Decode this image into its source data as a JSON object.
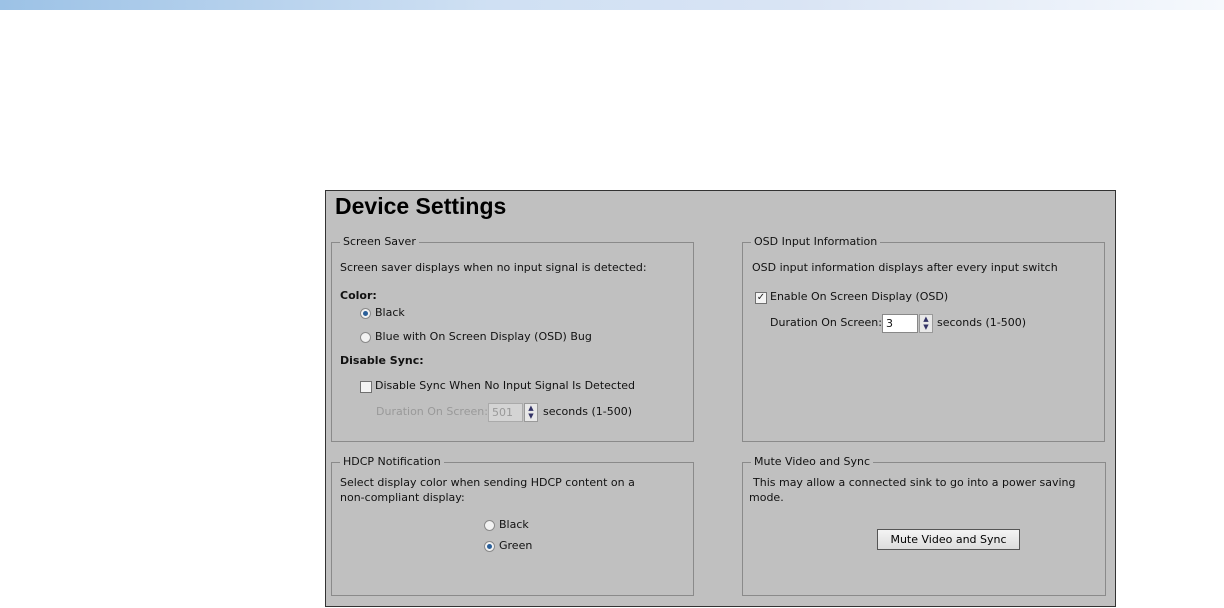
{
  "page": {
    "title": "Device Settings"
  },
  "screen_saver": {
    "legend": "Screen Saver",
    "description": "Screen saver displays when no input signal is detected:",
    "color_label": "Color:",
    "options": [
      {
        "label": "Black",
        "selected": true
      },
      {
        "label": "Blue with On Screen Display (OSD) Bug",
        "selected": false
      }
    ],
    "disable_sync_label": "Disable Sync:",
    "disable_sync_checkbox": "Disable Sync When No Input Signal Is Detected",
    "disable_sync_checked": false,
    "duration_label": "Duration On Screen:",
    "duration_value": "501",
    "duration_units": "seconds (1-500)"
  },
  "osd": {
    "legend": "OSD Input Information",
    "description": "OSD input information displays after every input switch",
    "enable_label": "Enable On Screen Display (OSD)",
    "enable_checked": true,
    "duration_label": "Duration On Screen:",
    "duration_value": "3",
    "duration_units": "seconds (1-500)"
  },
  "hdcp": {
    "legend": "HDCP Notification",
    "description_line1": "Select display color when sending HDCP content on a",
    "description_line2": "non-compliant display:",
    "options": [
      {
        "label": "Black",
        "selected": false
      },
      {
        "label": "Green",
        "selected": true
      }
    ]
  },
  "mute": {
    "legend": "Mute Video and Sync",
    "description_line1": "This may allow a connected sink to go into a power saving",
    "description_line2": "mode.",
    "button_label": "Mute Video and Sync"
  },
  "icons": {
    "check": "✓",
    "spin_up": "▲",
    "spin_down": "▼"
  }
}
